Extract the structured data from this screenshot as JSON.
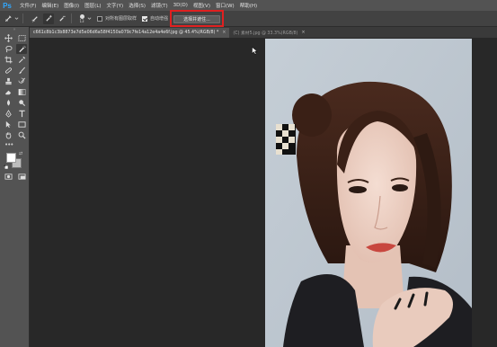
{
  "app": {
    "logo": "Ps"
  },
  "menu": [
    "文件(F)",
    "编辑(E)",
    "图像(I)",
    "图层(L)",
    "文字(Y)",
    "选择(S)",
    "滤镜(T)",
    "3D(D)",
    "视图(V)",
    "窗口(W)",
    "帮助(H)"
  ],
  "options": {
    "brush_size": "13",
    "sample_all_layers_label": "对所有图层取样",
    "sample_all_layers_checked": false,
    "auto_enhance_label": "自动增强",
    "auto_enhance_checked": true,
    "select_mask_button": "选择并遮住..."
  },
  "tabs": [
    {
      "label": "c661c8b1c3b8873e7d5e06d6a58f4150a079c7fe14a12e4a4e6f.jpg @ 45.4%(RGB/8) *",
      "active": true,
      "close": "×"
    },
    {
      "label": "(C) 素材5.jpg @ 33.3%(RGB/8)",
      "active": false,
      "close": "×"
    }
  ],
  "toolbar": {
    "grip": "»",
    "more": "•••",
    "selected_tool": "quick-selection-tool",
    "foreground_color": "#ffffff",
    "background_color": "#bdbdbd"
  },
  "colors": {
    "menubar": "#535353",
    "optionsbar": "#424242",
    "workspace": "#282828",
    "highlight": "#e02020",
    "ps_blue": "#31a8ff"
  }
}
